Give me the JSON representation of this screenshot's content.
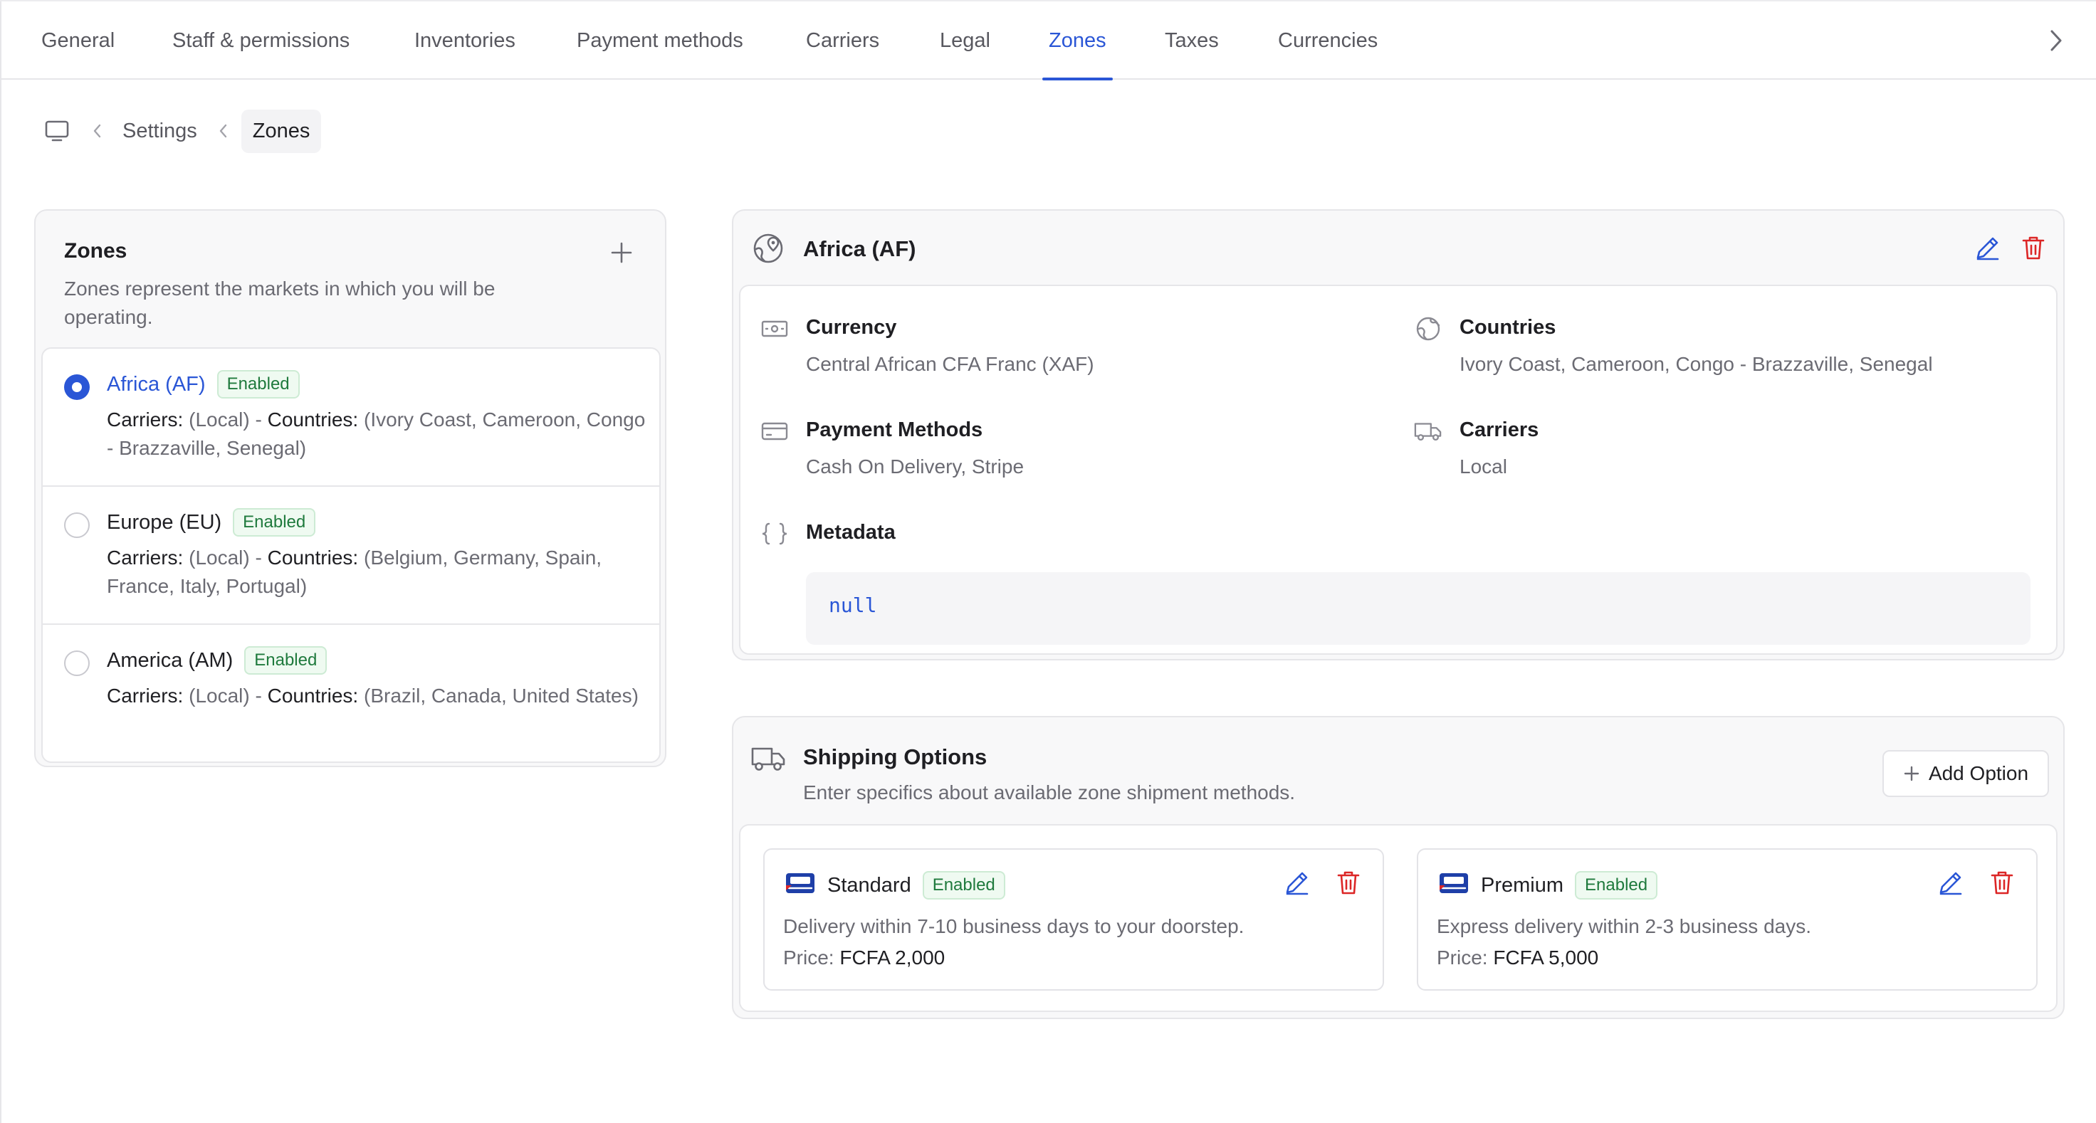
{
  "tabs": [
    {
      "label": "General",
      "active": false
    },
    {
      "label": "Staff & permissions",
      "active": false
    },
    {
      "label": "Inventories",
      "active": false
    },
    {
      "label": "Payment methods",
      "active": false
    },
    {
      "label": "Carriers",
      "active": false
    },
    {
      "label": "Legal",
      "active": false
    },
    {
      "label": "Zones",
      "active": true
    },
    {
      "label": "Taxes",
      "active": false
    },
    {
      "label": "Currencies",
      "active": false
    }
  ],
  "breadcrumb": {
    "home_icon": "monitor-icon",
    "items": [
      "Settings",
      "Zones"
    ]
  },
  "zones_panel": {
    "title": "Zones",
    "description": "Zones represent the markets in which you will be operating.",
    "add_icon": "plus-icon",
    "zones": [
      {
        "name": "Africa (AF)",
        "status": "Enabled",
        "selected": true,
        "carriers_label": "Carriers:",
        "carriers_value": "(Local) - ",
        "countries_label": "Countries:",
        "countries_value": "(Ivory Coast, Cameroon, Congo - Brazzaville, Senegal)"
      },
      {
        "name": "Europe (EU)",
        "status": "Enabled",
        "selected": false,
        "carriers_label": "Carriers:",
        "carriers_value": "(Local) - ",
        "countries_label": "Countries:",
        "countries_value": "(Belgium, Germany, Spain, France, Italy, Portugal)"
      },
      {
        "name": "America (AM)",
        "status": "Enabled",
        "selected": false,
        "carriers_label": "Carriers:",
        "carriers_value": "(Local) - ",
        "countries_label": "Countries:",
        "countries_value": "(Brazil, Canada, United States)"
      }
    ]
  },
  "zone_detail": {
    "title": "Africa (AF)",
    "header_icon": "globe-pin-icon",
    "currency": {
      "label": "Currency",
      "value": "Central African CFA Franc (XAF)",
      "icon": "banknote-icon"
    },
    "countries": {
      "label": "Countries",
      "value": "Ivory Coast, Cameroon, Congo - Brazzaville, Senegal",
      "icon": "globe-icon"
    },
    "payment_methods": {
      "label": "Payment Methods",
      "value": "Cash On Delivery, Stripe",
      "icon": "credit-card-icon"
    },
    "carriers": {
      "label": "Carriers",
      "value": "Local",
      "icon": "truck-icon"
    },
    "metadata": {
      "label": "Metadata",
      "value": "null",
      "icon": "braces-icon"
    }
  },
  "shipping": {
    "title": "Shipping Options",
    "description": "Enter specifics about available zone shipment methods.",
    "add_label": "Add Option",
    "options": [
      {
        "name": "Standard",
        "status": "Enabled",
        "description": "Delivery within 7-10 business days to your doorstep.",
        "price_label": "Price:",
        "price": "FCFA 2,000"
      },
      {
        "name": "Premium",
        "status": "Enabled",
        "description": "Express delivery within 2-3 business days.",
        "price_label": "Price:",
        "price": "FCFA 5,000"
      }
    ]
  },
  "colors": {
    "accent": "#2a56d6",
    "danger": "#dc2626",
    "success_text": "#1f7a3d",
    "success_bg": "#effaf1"
  }
}
